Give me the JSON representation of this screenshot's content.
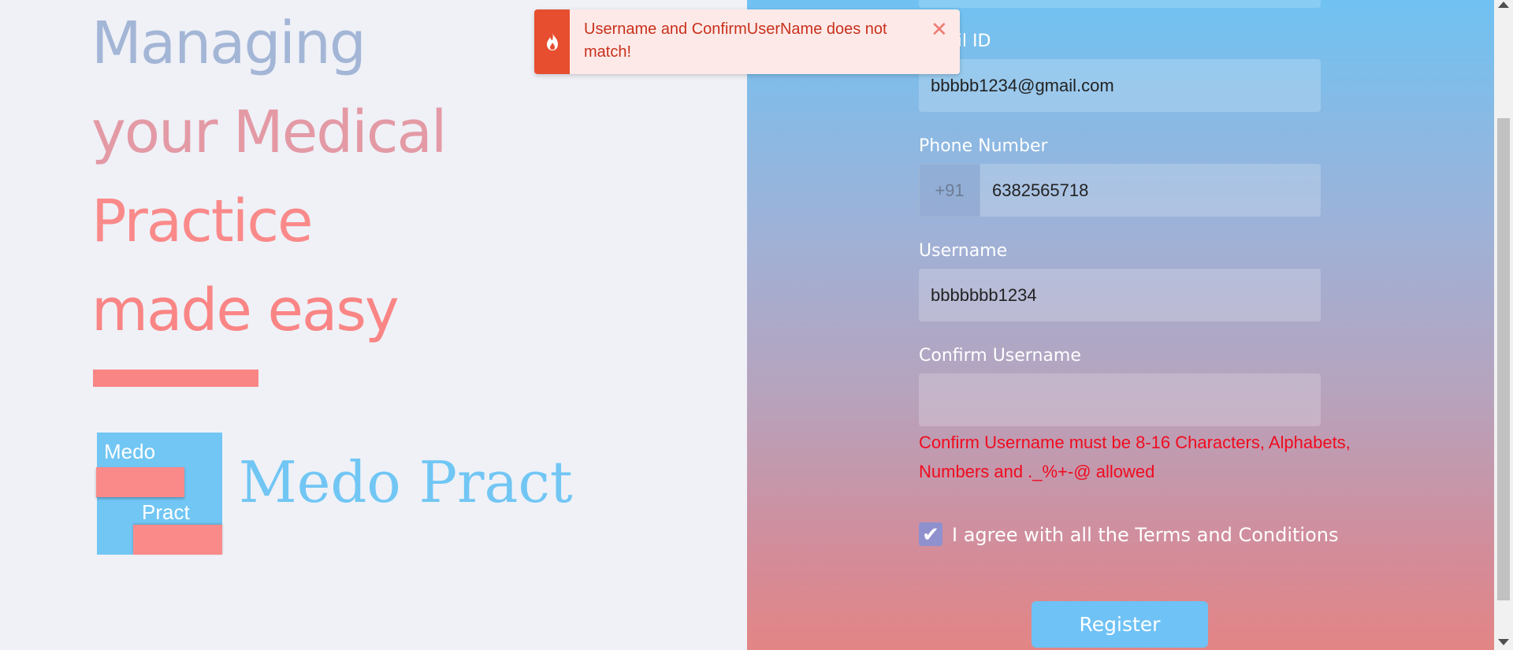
{
  "hero": {
    "line1": "Managing",
    "line2": "your Medical",
    "line3": "Practice",
    "line4": "made easy"
  },
  "logo": {
    "top_text": "Medo",
    "bottom_text": "Pract",
    "brand_name": "Medo Pract"
  },
  "form": {
    "email_label": "Email ID",
    "email_value": "bbbbb1234@gmail.com",
    "phone_label": "Phone Number",
    "phone_prefix": "+91",
    "phone_value": "6382565718",
    "username_label": "Username",
    "username_value": "bbbbbbb1234",
    "confirm_label": "Confirm Username",
    "confirm_value": "",
    "confirm_error": "Confirm Username must be 8-16 Characters, Alphabets, Numbers and ._%+-@ allowed",
    "terms_label": "I agree with all the Terms and Conditions",
    "terms_checked": true,
    "register_label": "Register"
  },
  "toast": {
    "message": "Username and ConfirmUserName does not match!",
    "icon": "fire-icon",
    "close_icon": "close-icon"
  },
  "colors": {
    "accent_blue": "#71c6f4",
    "accent_red": "#fa8585",
    "error": "#f00b1f",
    "toast_accent": "#e74e2f"
  }
}
